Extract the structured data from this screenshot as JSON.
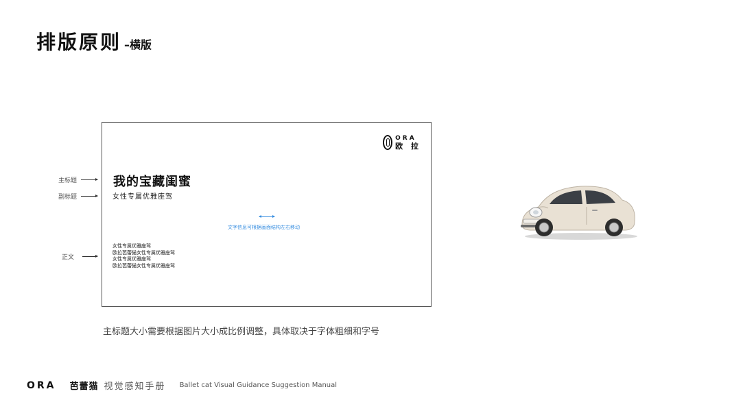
{
  "header": {
    "title": "排版原则",
    "subtitle": "–横版"
  },
  "labels": {
    "main_title": "主标题",
    "subtitle": "副标题",
    "body": "正文"
  },
  "frame": {
    "logo_line1": "ORA",
    "logo_line2": "欧 拉",
    "main_title": "我的宝藏闺蜜",
    "sub_title": "女性专属优雅座驾",
    "move_note": "文字信息可根据画面结构左右移动",
    "body_lines": [
      "女性专属优雅座驾",
      "欧拉芭蕾猫女性专属优雅座驾",
      "女性专属优雅座驾",
      "欧拉芭蕾猫女性专属优雅座驾"
    ]
  },
  "caption": "主标题大小需要根据图片大小成比例调整，具体取决于字体粗细和字号",
  "footer": {
    "ora": "ORA",
    "brand": "芭蕾猫",
    "manual_cn": "视觉感知手册",
    "manual_en": "Ballet cat Visual Guidance Suggestion Manual"
  },
  "colors": {
    "accent_blue": "#3a8fe0",
    "car_body": "#e9e1d4"
  }
}
